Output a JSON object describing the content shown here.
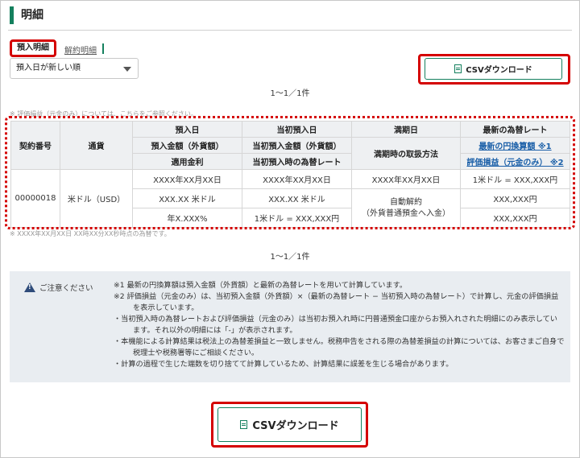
{
  "page": {
    "title": "明細"
  },
  "tabs": {
    "active": "預入明細",
    "other": "解約明細"
  },
  "sort": {
    "selected": "預入日が新しい順"
  },
  "csv": {
    "label": "CSVダウンロード"
  },
  "pager": {
    "top": "1〜1／1件",
    "bottom": "1〜1／1件"
  },
  "notes": {
    "above": "※ 評価損益（元金のみ）については、こちらをご参照ください。",
    "below": "※ XXXX年XX月XX日 XX時XX分XX秒時点の為替です。"
  },
  "table": {
    "headers": {
      "contract_no": "契約番号",
      "currency": "通貨",
      "deposit_date": "預入日",
      "deposit_amount": "預入金額（外貨額）",
      "rate": "適用金利",
      "initial_date": "当初預入日",
      "initial_amount": "当初預入金額（外貨額）",
      "initial_fx": "当初預入時の為替レート",
      "maturity_date": "満期日",
      "maturity_handling": "満期時の取扱方法",
      "latest_fx": "最新の為替レート",
      "latest_yen": "最新の円換算額 ※1",
      "pl": "評価損益（元金のみ） ※2"
    },
    "row": {
      "contract_no": "00000018",
      "currency": "米ドル（USD）",
      "deposit_date": "XXXX年XX月XX日",
      "deposit_amount": "XXX.XX 米ドル",
      "rate": "年X.XXX%",
      "initial_date": "XXXX年XX月XX日",
      "initial_amount": "XXX.XX 米ドル",
      "initial_fx": "1米ドル = XXX,XXX円",
      "maturity_date": "XXXX年XX月XX日",
      "maturity_handling": "自動解約\n（外貨普通預金へ入金）",
      "latest_fx": "1米ドル = XXX,XXX円",
      "latest_yen": "XXX,XXX円",
      "pl": "XXX,XXX円"
    }
  },
  "caution": {
    "label": "ご注意ください",
    "items": [
      "※1 最新の円換算額は預入金額（外貨額）と最新の為替レートを用いて計算しています。",
      "※2 評価損益（元金のみ）は、当初預入金額（外貨額）×（最新の為替レート − 当初預入時の為替レート）で計算し、元金の評価損益を表示しています。",
      "・当初預入時の為替レートおよび評価損益（元金のみ）は当初お預入れ時に円普通預金口座からお預入れされた明細にのみ表示しています。それ以外の明細には「-」が表示されます。",
      "・本機能による計算結果は税法上の為替差損益と一致しません。税務申告をされる際の為替差損益の計算については、お客さまご自身で税理士や税務署等にご相談ください。",
      "・計算の過程で生じた端数を切り捨てて計算しているため、計算結果に誤差を生じる場合があります。"
    ]
  },
  "colors": {
    "accent": "#14805e",
    "highlight": "#d40000",
    "link": "#1a5fa8",
    "caution_bg": "#e9edf1"
  },
  "icons": {
    "csv": "csv-file-icon",
    "warning": "warning-icon",
    "dropdown": "chevron-down-icon"
  }
}
